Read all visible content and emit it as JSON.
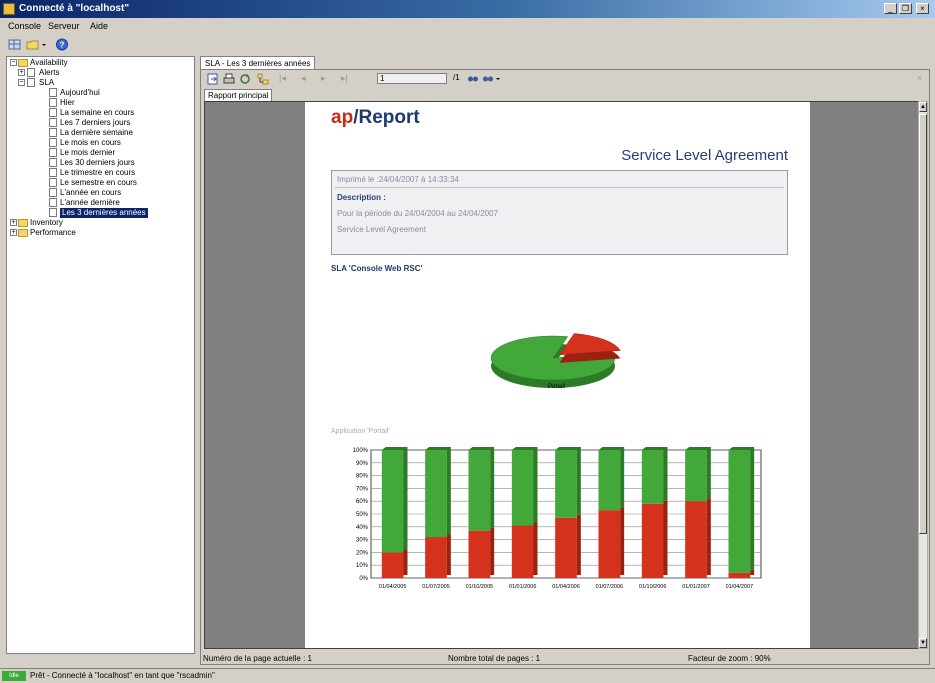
{
  "window": {
    "title": "Connecté à \"localhost\"",
    "min": "_",
    "max": "❐",
    "close": "×"
  },
  "menu": [
    "Console",
    "Serveur",
    "Aide"
  ],
  "tree": {
    "availability": "Availability",
    "alerts": "Alerts",
    "sla": "SLA",
    "sla_items": [
      "Aujourd'hui",
      "Hier",
      "La semaine en cours",
      "Les 7 derniers jours",
      "La dernière semaine",
      "Le mois en cours",
      "Le mois dernier",
      "Les 30 derniers jours",
      "Le trimestre en cours",
      "Le semestre en cours",
      "L'année en cours",
      "L'année dernière",
      "Les 3 dernières années"
    ],
    "inventory": "Inventory",
    "performance": "Performance"
  },
  "doc_tab": "SLA - Les 3 dernières années",
  "report_toolbar": {
    "page_value": "1",
    "page_total": "/1"
  },
  "subtab": "Rapport principal",
  "report": {
    "logo_ap": "ap",
    "logo_slash": "/",
    "logo_report": "Report",
    "title": "Service Level Agreement",
    "printed": "Imprimé le :24/04/2007 à 14:33:34",
    "desc_label": "Description :",
    "period": "Pour la période du 24/04/2004 au 24/04/2007",
    "desc_text": "Service Level Agreement",
    "sla_title": "SLA 'Console Web RSC'",
    "pie_label": "Portail",
    "app_label": "Application 'Portail'"
  },
  "chart_data": {
    "type": "bar",
    "stacked": true,
    "categories": [
      "01/04/2005",
      "01/07/2005",
      "01/10/2005",
      "01/01/2006",
      "01/04/2006",
      "01/07/2006",
      "01/10/2006",
      "01/01/2007",
      "01/04/2007"
    ],
    "series": [
      {
        "values": [
          20,
          32,
          37,
          41,
          47,
          53,
          58,
          60,
          4
        ],
        "color": "#d4321c"
      },
      {
        "values": [
          80,
          68,
          63,
          59,
          53,
          47,
          42,
          40,
          96
        ],
        "color": "#43a83a"
      }
    ],
    "yticks": [
      "0%",
      "10%",
      "20%",
      "30%",
      "40%",
      "50%",
      "60%",
      "70%",
      "80%",
      "90%",
      "100%"
    ],
    "ylim": [
      0,
      100
    ],
    "grid": true
  },
  "pie_data": {
    "type": "pie",
    "slices": [
      {
        "value": 82,
        "color": "#43a83a"
      },
      {
        "value": 18,
        "color": "#d4321c"
      }
    ]
  },
  "doc_status": {
    "page": "Numéro de la page actuelle : 1",
    "total": "Nombre total de pages : 1",
    "zoom": "Facteur de zoom : 90%"
  },
  "status": {
    "badge": "Idle",
    "text": "Prêt - Connecté à \"localhost\" en tant que \"rscadmin\""
  }
}
